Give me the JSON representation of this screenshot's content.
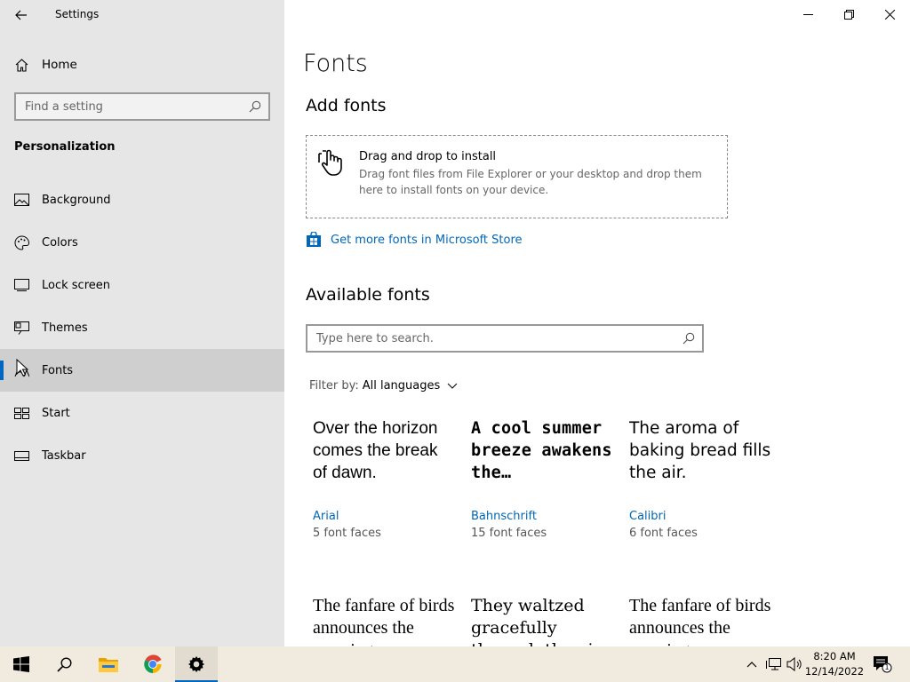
{
  "window": {
    "title": "Settings"
  },
  "sidebar": {
    "home_label": "Home",
    "search_placeholder": "Find a setting",
    "section_title": "Personalization",
    "items": [
      {
        "label": "Background",
        "icon": "picture-icon"
      },
      {
        "label": "Colors",
        "icon": "palette-icon"
      },
      {
        "label": "Lock screen",
        "icon": "lock-screen-icon"
      },
      {
        "label": "Themes",
        "icon": "themes-icon"
      },
      {
        "label": "Fonts",
        "icon": "fonts-icon",
        "active": true
      },
      {
        "label": "Start",
        "icon": "start-icon"
      },
      {
        "label": "Taskbar",
        "icon": "taskbar-icon"
      }
    ]
  },
  "main": {
    "title": "Fonts",
    "add_heading": "Add fonts",
    "drop_title": "Drag and drop to install",
    "drop_desc": "Drag font files from File Explorer or your desktop and drop them here to install fonts on your device.",
    "store_link": "Get more fonts in Microsoft Store",
    "available_heading": "Available fonts",
    "search_placeholder": "Type here to search.",
    "filter_label": "Filter by:",
    "filter_value": "All languages",
    "fonts": [
      {
        "sample": "Over the horizon comes the break of dawn.",
        "name": "Arial",
        "faces": "5 font faces"
      },
      {
        "sample": "A cool summer breeze awakens the…",
        "name": "Bahnschrift",
        "faces": "15 font faces"
      },
      {
        "sample": "The aroma of baking bread fills the air.",
        "name": "Calibri",
        "faces": "6 font faces"
      },
      {
        "sample": "The fanfare of birds announces the morning.",
        "name": "",
        "faces": ""
      },
      {
        "sample": "They waltzed gracefully through the air.",
        "name": "",
        "faces": ""
      },
      {
        "sample": "The fanfare of birds announces the morning.",
        "name": "",
        "faces": ""
      }
    ]
  },
  "taskbar": {
    "time": "8:20 AM",
    "date": "12/14/2022",
    "notification_count": "1",
    "accent": "#0067c0"
  }
}
